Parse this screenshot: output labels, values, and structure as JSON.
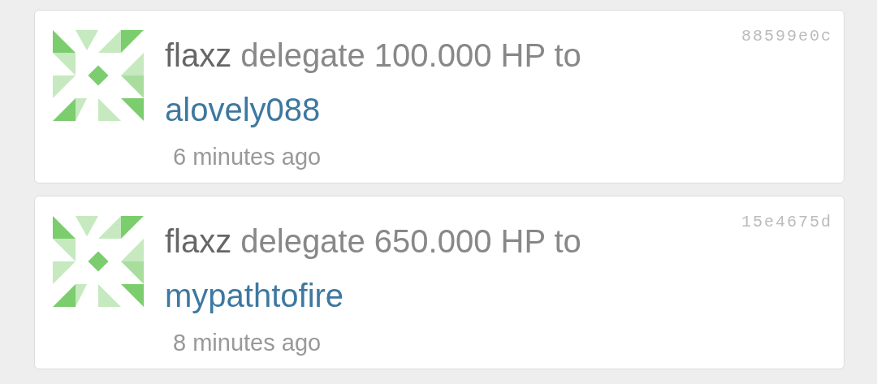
{
  "activities": [
    {
      "user": "flaxz",
      "action": "delegate 100.000 HP to",
      "target": "alovely088",
      "time": "6 minutes ago",
      "hash": "88599e0c"
    },
    {
      "user": "flaxz",
      "action": "delegate 650.000 HP to",
      "target": "mypathtofire",
      "time": "8 minutes ago",
      "hash": "15e4675d"
    }
  ]
}
